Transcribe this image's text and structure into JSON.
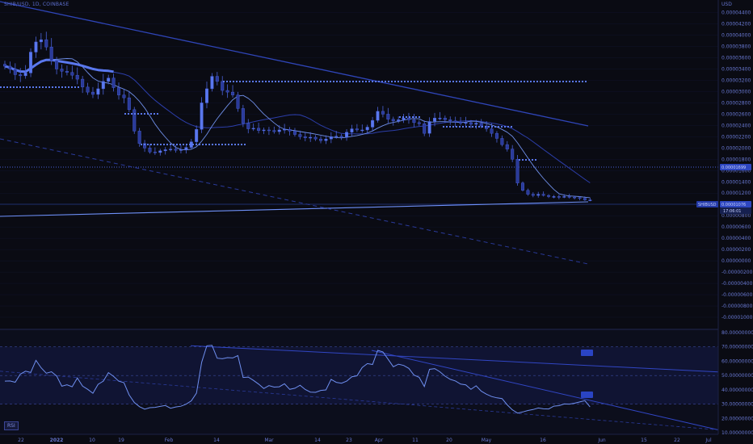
{
  "header": {
    "symbol_line": "SHIB/USD, 1D, COINBASE",
    "currency": "USD"
  },
  "price_flags": {
    "symbol": "SHIBUSD",
    "last_price": "0.00001076",
    "countdown": "17:06:01",
    "level_price": "0.00001699"
  },
  "indicator": {
    "label": "RSI"
  },
  "colors": {
    "background": "#0a0b13",
    "candle": "#4a62d8",
    "line": "#3848c0",
    "accent": "#6e82f2",
    "flag": "#3247b8"
  },
  "chart_data": [
    {
      "type": "candlestick",
      "title": "SHIB/USD, 1D, COINBASE",
      "ylabel": "USD",
      "ylim": [
        -1.1e-05,
        4.48e-05
      ],
      "y_ticks": [
        "0.00004400",
        "0.00004200",
        "0.00004000",
        "0.00003800",
        "0.00003600",
        "0.00003400",
        "0.00003200",
        "0.00003000",
        "0.00002800",
        "0.00002600",
        "0.00002400",
        "0.00002200",
        "0.00002000",
        "0.00001800",
        "0.00001600",
        "0.00001400",
        "0.00001200",
        "0.00001000",
        "0.00000800",
        "0.00000600",
        "0.00000400",
        "0.00000200",
        "0.00000000",
        "-0.00000200",
        "-0.00000400",
        "-0.00000600",
        "-0.00000800",
        "-0.00001000"
      ],
      "x_ticks": [
        "22",
        "2022",
        "10",
        "19",
        "Feb",
        "14",
        "Mar",
        "14",
        "23",
        "Apr",
        "11",
        "20",
        "May",
        "16",
        "Jun",
        "15",
        "22",
        "Jul"
      ],
      "closes": [
        3.45e-05,
        3.4e-05,
        3.3e-05,
        3.28e-05,
        3.33e-05,
        3.7e-05,
        3.88e-05,
        3.92e-05,
        3.79e-05,
        3.55e-05,
        3.4e-05,
        3.36e-05,
        3.34e-05,
        3.29e-05,
        3.22e-05,
        3.08e-05,
        2.99e-05,
        2.95e-05,
        3.05e-05,
        3.18e-05,
        3.24e-05,
        3.07e-05,
        2.94e-05,
        2.89e-05,
        2.68e-05,
        2.3e-05,
        2.08e-05,
        2e-05,
        1.93e-05,
        1.92e-05,
        1.95e-05,
        1.97e-05,
        1.98e-05,
        1.96e-05,
        1.97e-05,
        2.01e-05,
        2.11e-05,
        2.33e-05,
        2.8e-05,
        3.05e-05,
        3.27e-05,
        3.18e-05,
        3.02e-05,
        2.99e-05,
        2.94e-05,
        2.7e-05,
        2.44e-05,
        2.34e-05,
        2.35e-05,
        2.31e-05,
        2.32e-05,
        2.31e-05,
        2.29e-05,
        2.32e-05,
        2.33e-05,
        2.3e-05,
        2.24e-05,
        2.2e-05,
        2.18e-05,
        2.19e-05,
        2.16e-05,
        2.13e-05,
        2.16e-05,
        2.2e-05,
        2.21e-05,
        2.19e-05,
        2.28e-05,
        2.34e-05,
        2.32e-05,
        2.32e-05,
        2.37e-05,
        2.49e-05,
        2.65e-05,
        2.6e-05,
        2.51e-05,
        2.48e-05,
        2.5e-05,
        2.53e-05,
        2.5e-05,
        2.45e-05,
        2.43e-05,
        2.26e-05,
        2.47e-05,
        2.53e-05,
        2.53e-05,
        2.5e-05,
        2.48e-05,
        2.46e-05,
        2.44e-05,
        2.45e-05,
        2.42e-05,
        2.44e-05,
        2.39e-05,
        2.34e-05,
        2.26e-05,
        2.17e-05,
        2.06e-05,
        1.98e-05,
        1.8e-05,
        1.38e-05,
        1.25e-05,
        1.18e-05,
        1.16e-05,
        1.18e-05,
        1.16e-05,
        1.14e-05,
        1.14e-05,
        1.13e-05,
        1.14e-05,
        1.13e-05,
        1.12e-05,
        1.11e-05,
        1.08e-05,
        1.08e-05
      ]
    },
    {
      "type": "line",
      "title": "RSI",
      "ylim": [
        10,
        80
      ],
      "y_ticks": [
        "80.00000000",
        "70.00000000",
        "60.00000000",
        "50.00000000",
        "40.00000000",
        "30.00000000",
        "20.00000000",
        "10.00000000"
      ],
      "levels": [
        70,
        50,
        30
      ],
      "values": [
        46.1,
        46.2,
        45.3,
        51.0,
        53.0,
        52.1,
        60.6,
        55.4,
        51.6,
        52.6,
        49.7,
        42.5,
        43.5,
        42.1,
        48.3,
        42.6,
        40.3,
        37.6,
        43.8,
        46.0,
        52.0,
        49.4,
        46.0,
        45.0,
        36.5,
        31.1,
        28.2,
        26.5,
        27.5,
        27.7,
        28.4,
        29.0,
        27.1,
        28.0,
        28.5,
        29.9,
        32.3,
        37.7,
        59.2,
        70.8,
        71.1,
        62.1,
        61.7,
        62.5,
        62.3,
        63.9,
        48.6,
        48.9,
        46.6,
        44.0,
        40.9,
        42.9,
        41.9,
        42.1,
        44.2,
        40.3,
        41.1,
        43.2,
        40.2,
        38.4,
        38.2,
        39.6,
        39.9,
        47.3,
        45.2,
        44.6,
        46.1,
        49.1,
        49.8,
        55.6,
        58.3,
        57.7,
        67.6,
        66.5,
        61.4,
        56.1,
        57.9,
        57.0,
        55.0,
        50.3,
        48.7,
        42.3,
        54.3,
        54.8,
        52.6,
        49.5,
        47.3,
        46.2,
        44.0,
        43.5,
        40.3,
        42.8,
        39.0,
        36.9,
        35.3,
        34.4,
        33.9,
        29.5,
        26.0,
        23.7,
        24.5,
        25.5,
        26.2,
        27.3,
        26.7,
        26.6,
        28.6,
        28.9,
        30.1,
        30.0,
        30.6,
        31.5,
        32.4,
        28.0
      ]
    }
  ]
}
